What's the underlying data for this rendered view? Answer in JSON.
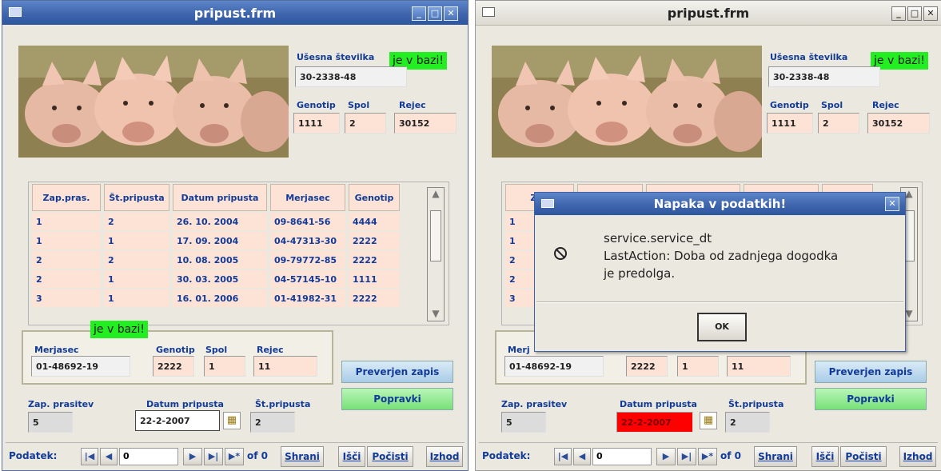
{
  "windows": [
    {
      "title": "pripust.frm",
      "ear_label": "Ušesna številka",
      "ear_value": "30-2338-48",
      "badge_text": "je v bazi!",
      "genotip_label": "Genotip",
      "spol_label": "Spol",
      "rejec_label": "Rejec",
      "genotip_value": "1111",
      "spol_value": "2",
      "rejec_value": "30152",
      "table": {
        "headers": [
          "Zap.pras.",
          "Št.pripusta",
          "Datum pripusta",
          "Merjasec",
          "Genotip"
        ],
        "rows": [
          [
            "1",
            "2",
            "26. 10. 2004",
            "09-8641-56",
            "4444"
          ],
          [
            "1",
            "1",
            "17. 09. 2004",
            "04-47313-30",
            "2222"
          ],
          [
            "2",
            "2",
            "10. 08. 2005",
            "09-79772-85",
            "2222"
          ],
          [
            "2",
            "1",
            "30. 03. 2005",
            "04-57145-10",
            "1111"
          ],
          [
            "3",
            "1",
            "16. 01. 2006",
            "01-41982-31",
            "2222"
          ]
        ]
      },
      "boar": {
        "badge_text": "je v bazi!",
        "merjasec_label": "Merjasec",
        "merjasec_value": "01-48692-19",
        "genotip_label": "Genotip",
        "genotip_value": "2222",
        "spol_label": "Spol",
        "spol_value": "1",
        "rejec_label": "Rejec",
        "rejec_value": "11"
      },
      "zap_label": "Zap. prasitev",
      "zap_value": "5",
      "datum_label": "Datum pripusta",
      "datum_value": "22-2-2007",
      "st_label": "Št.pripusta",
      "st_value": "2",
      "btn_preverjen": "Preverjen zapis",
      "btn_popravki": "Popravki",
      "nav": {
        "label": "Podatek:",
        "first": "|◀",
        "prev": "◀",
        "value": "0",
        "next": "▶",
        "last": "▶|",
        "new": "▶*",
        "of": "of 0",
        "shrani": "Shrani",
        "isci": "Išči",
        "pocisti": "Počisti",
        "izhod": "Izhod"
      }
    },
    {
      "title": "pripust.frm",
      "ear_label": "Ušesna številka",
      "ear_value": "30-2338-48",
      "badge_text": "je v bazi!",
      "genotip_label": "Genotip",
      "spol_label": "Spol",
      "rejec_label": "Rejec",
      "genotip_value": "1111",
      "spol_value": "2",
      "rejec_value": "30152",
      "table": {
        "headers": [
          "Zap",
          "",
          "",
          "",
          ""
        ],
        "rows": [
          [
            "1"
          ],
          [
            "1"
          ],
          [
            "2"
          ],
          [
            "2"
          ],
          [
            "3"
          ]
        ]
      },
      "boar": {
        "merjasec_label": "Merj",
        "merjasec_value": "01-48692-19",
        "genotip_value": "2222",
        "spol_value": "1",
        "rejec_value": "11"
      },
      "zap_label": "Zap. prasitev",
      "zap_value": "5",
      "datum_label": "Datum pripusta",
      "datum_value": "22-2-2007",
      "st_label": "Št.pripusta",
      "st_value": "2",
      "btn_preverjen": "Preverjen zapis",
      "btn_popravki": "Popravki",
      "nav": {
        "label": "Podatek:",
        "first": "|◀",
        "prev": "◀",
        "value": "0",
        "next": "▶",
        "last": "▶|",
        "new": "▶*",
        "of": "of 0",
        "shrani": "Shrani",
        "isci": "Išči",
        "pocisti": "Počisti",
        "izhod": "Izhod"
      }
    }
  ],
  "dialog": {
    "title": "Napaka v podatkih!",
    "lines": [
      "service.service_dt",
      "LastAction: Doba od zadnjega dogodka",
      "je predolga."
    ],
    "ok": "OK",
    "close": "✕"
  },
  "window_controls": {
    "minimize": "_",
    "maximize": "□",
    "close": "✕"
  },
  "icons": {
    "calendar": "calendar-icon",
    "stop": "stop-icon"
  },
  "colors": {
    "badge": "#22ee22",
    "error_field": "#ff0000",
    "title_active": "#3f66ad",
    "field_pink": "#fde3d6"
  }
}
